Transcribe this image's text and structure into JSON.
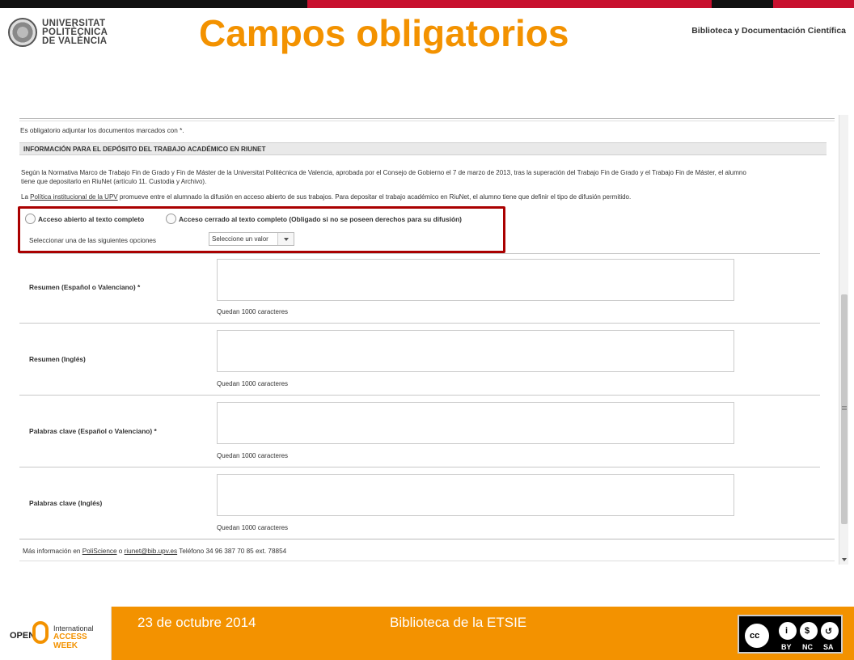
{
  "header": {
    "university": [
      "UNIVERSITAT",
      "POLITÈCNICA",
      "DE VALÈNCIA"
    ],
    "title": "Campos obligatorios",
    "right_label": "Biblioteca y Documentación Científica"
  },
  "form": {
    "required_note": "Es obligatorio adjuntar los documentos marcados con *.",
    "section_title": "INFORMACIÓN PARA EL DEPÓSITO DEL TRABAJO ACADÉMICO EN RIUNET",
    "paragraph1_line1": "Según la Normativa Marco de Trabajo Fin de Grado y Fin de Máster de la Universitat Politècnica de Valencia, aprobada por el Consejo de Gobierno el 7 de marzo de 2013, tras la superación del Trabajo Fin de Grado y el Trabajo Fin de Máster, el alumno",
    "paragraph1_line2": "tiene que depositarlo en RiuNet (artículo 11. Custodia y Archivo).",
    "paragraph2_prefix": "La ",
    "paragraph2_link": "Política institucional de la UPV",
    "paragraph2_suffix": " promueve entre el alumnado la difusión en acceso abierto de sus trabajos. Para depositar el trabajo académico en RiuNet, el alumno tiene que definir el tipo de difusión permitido.",
    "radio_open": "Acceso abierto al texto completo",
    "radio_closed": "Acceso cerrado al texto completo (Obligado si no se poseen derechos para su difusión)",
    "select_label": "Seleccionar una de las siguientes opciones",
    "select_value": "Seleccione un valor",
    "fields": [
      {
        "label": "Resumen (Español o Valenciano) *",
        "counter": "Quedan 1000 caracteres"
      },
      {
        "label": "Resumen (Inglés)",
        "counter": "Quedan 1000 caracteres"
      },
      {
        "label": "Palabras clave (Español o Valenciano) *",
        "counter": "Quedan 1000 caracteres"
      },
      {
        "label": "Palabras clave (Inglés)",
        "counter": "Quedan 1000 caracteres"
      }
    ],
    "more_info_prefix": "Más información en ",
    "more_info_link1": "PoliScience",
    "more_info_mid": " o ",
    "more_info_link2": "riunet@bib.upv.es",
    "more_info_suffix": " Teléfono 34 96 387 70 85 ext. 78854"
  },
  "footer": {
    "oaw_open": "OPEN",
    "oaw_international": "International",
    "oaw_access_week": "ACCESS WEEK",
    "date": "23 de octubre 2014",
    "org": "Biblioteca de la ETSIE",
    "cc_labels": [
      "BY",
      "NC",
      "SA"
    ]
  },
  "colors": {
    "accent": "#f39200",
    "highlight": "#aa0000",
    "brand_red": "#c8102e"
  }
}
